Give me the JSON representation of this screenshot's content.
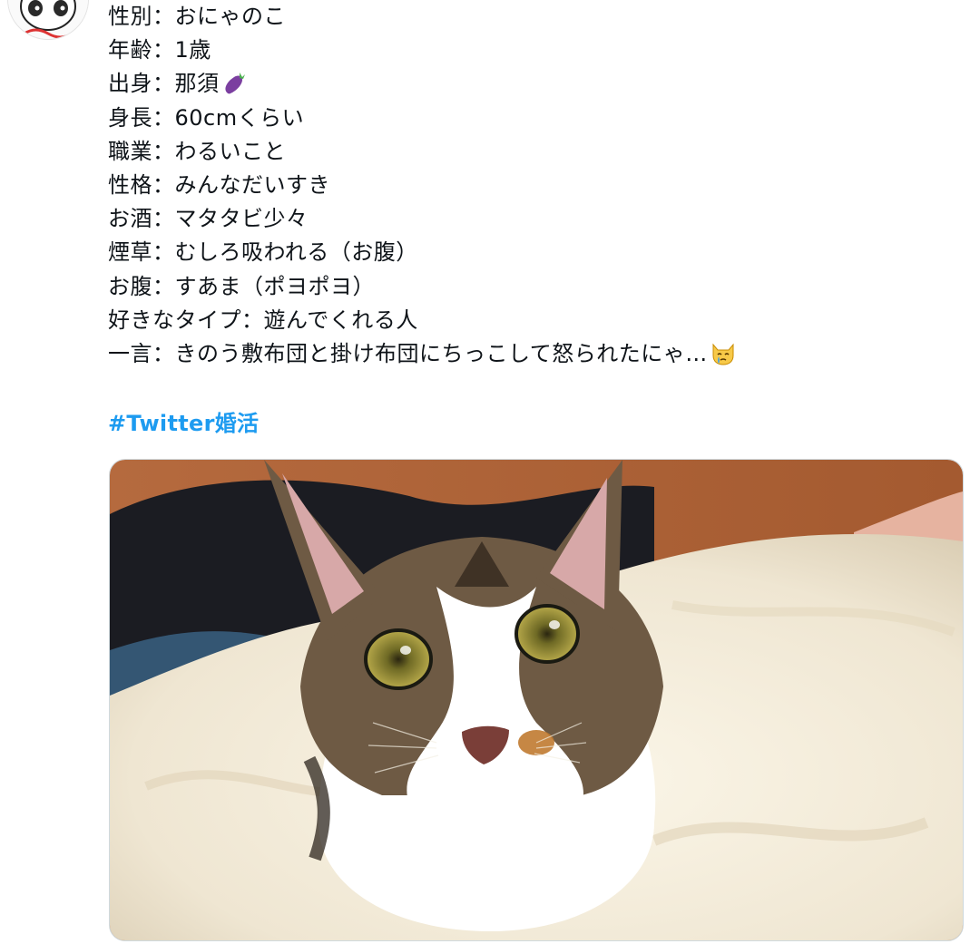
{
  "avatar": {
    "icon": "cat-avatar-icon"
  },
  "profile_lines": [
    {
      "label": "性別",
      "sep": "：",
      "value": "おにゃのこ"
    },
    {
      "label": "年齢",
      "sep": "：",
      "value": "1歳"
    },
    {
      "label": "出身",
      "sep": "：",
      "value": "那須",
      "emoji": "eggplant-emoji"
    },
    {
      "label": "身長",
      "sep": "：",
      "value": "60cmくらい"
    },
    {
      "label": "職業",
      "sep": "：",
      "value": "わるいこと"
    },
    {
      "label": "性格",
      "sep": "：",
      "value": "みんなだいすき"
    },
    {
      "label": "お酒",
      "sep": "：",
      "value": "マタタビ少々"
    },
    {
      "label": "煙草",
      "sep": "：",
      "value": "むしろ吸われる（お腹）"
    },
    {
      "label": "お腹",
      "sep": "：",
      "value": "すあま（ポヨポヨ）"
    },
    {
      "label": "好きなタイプ",
      "sep": "：",
      "value": "遊んでくれる人"
    },
    {
      "label": "一言",
      "sep": "：",
      "value": "きのう敷布団と掛け布団にちっこして怒られたにゃ…",
      "emoji": "crying-cat-emoji"
    }
  ],
  "hashtag": "#Twitter婚活",
  "media": {
    "icon": "cat-photo"
  },
  "colors": {
    "text": "#0f1419",
    "link": "#1d9bf0",
    "border": "#cfd9de",
    "eggplant": "#7b3fa0",
    "leaf": "#4caf50",
    "cat_emoji": "#f7c948",
    "tear": "#4aa3df"
  }
}
